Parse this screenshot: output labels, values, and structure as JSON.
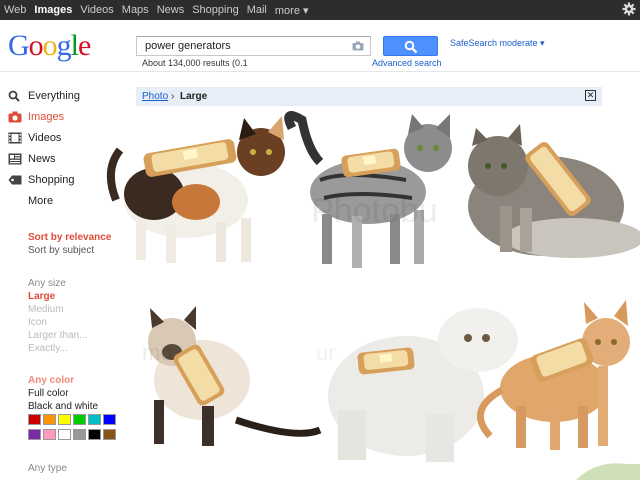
{
  "topbar": {
    "items": [
      "Web",
      "Images",
      "Videos",
      "Maps",
      "News",
      "Shopping",
      "Mail",
      "more ▾"
    ],
    "active_index": 1
  },
  "logo": {
    "letters": [
      "G",
      "o",
      "o",
      "g",
      "l",
      "e"
    ],
    "colors": [
      "#3369e8",
      "#d50f25",
      "#eeb211",
      "#3369e8",
      "#009925",
      "#d50f25"
    ]
  },
  "search": {
    "query": "power generators",
    "button_icon": "search-icon"
  },
  "safesearch": "SafeSearch moderate ▾",
  "results_count": "About 134,000 results (0.1",
  "advanced_search": "Advanced search",
  "left_nav": [
    {
      "label": "Everything",
      "icon": "search-icon"
    },
    {
      "label": "Images",
      "icon": "camera-icon"
    },
    {
      "label": "Videos",
      "icon": "film-icon"
    },
    {
      "label": "News",
      "icon": "newspaper-icon"
    },
    {
      "label": "Shopping",
      "icon": "tag-icon"
    },
    {
      "label": "More",
      "icon": ""
    }
  ],
  "sort": {
    "selected": "Sort by relevance",
    "other": "Sort by subject"
  },
  "size": {
    "any": "Any size",
    "selected": "Large",
    "medium": "Medium",
    "icon": "Icon",
    "larger": "Larger than...",
    "exactly": "Exactly..."
  },
  "color": {
    "any": "Any color",
    "full": "Full color",
    "bw": "Black and white",
    "swatches": [
      "#cc0000",
      "#fb940b",
      "#ffff00",
      "#00cc00",
      "#03c0c6",
      "#0000ff",
      "#762ca7",
      "#ff98bf",
      "#ffffff",
      "#999999",
      "#000000",
      "#885418"
    ]
  },
  "type": {
    "any": "Any type"
  },
  "breadcrumb": {
    "link": "Photo",
    "separator": "›",
    "current": "Large",
    "close": "✕"
  },
  "accent": {
    "red": "#dd4b39",
    "link": "#1a5fcc",
    "button": "#4d90fe"
  }
}
